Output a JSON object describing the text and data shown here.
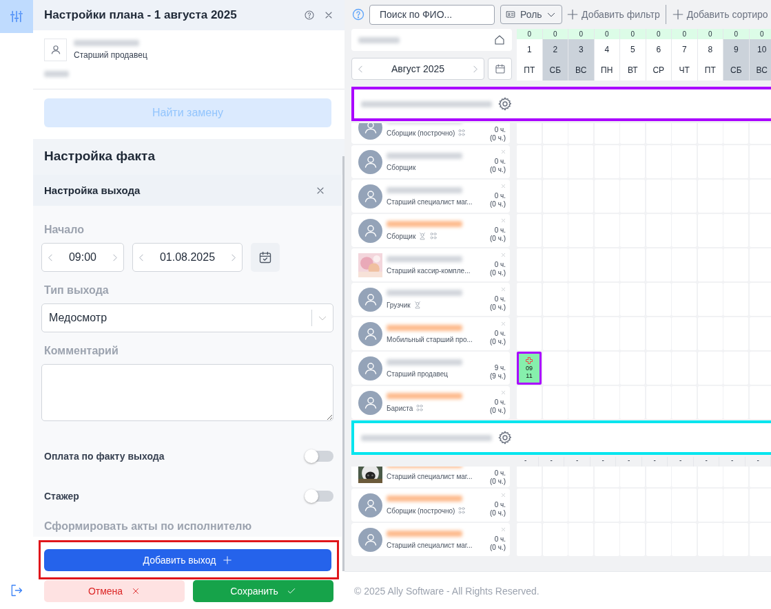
{
  "rail": {
    "top_active": true
  },
  "panel": {
    "title": "Настройки плана - 1 августа 2025",
    "employee": {
      "role": "Старший продавец"
    },
    "find_button": {
      "label": "Найти замену",
      "disabled": true
    },
    "section_title": "Настройка факта",
    "subsection_title": "Настройка выхода",
    "start": {
      "label": "Начало",
      "time": "09:00",
      "date": "01.08.2025"
    },
    "type": {
      "label": "Тип выхода",
      "value": "Медосмотр"
    },
    "comment": {
      "label": "Комментарий"
    },
    "toggles": [
      {
        "label": "Оплата по факту выхода",
        "on": false
      },
      {
        "label": "Стажер",
        "on": false
      }
    ],
    "acts_link": "Сформировать акты по исполнителю",
    "add_button": {
      "label": "Добавить выход",
      "outlined": true
    },
    "cancel_button": "Отмена",
    "save_button": "Сохранить"
  },
  "toolbar": {
    "search_placeholder": "Поиск по ФИО...",
    "role_filter": "Роль",
    "add_filter": "Добавить фильтр",
    "add_sort": "Добавить сортиро"
  },
  "month": "Август 2025",
  "days": [
    {
      "count": "0",
      "day": "1",
      "weekday": "ПТ",
      "weekend": false
    },
    {
      "count": "0",
      "day": "2",
      "weekday": "СБ",
      "weekend": true
    },
    {
      "count": "0",
      "day": "3",
      "weekday": "ВС",
      "weekend": true
    },
    {
      "count": "0",
      "day": "4",
      "weekday": "ПН",
      "weekend": false
    },
    {
      "count": "0",
      "day": "5",
      "weekday": "ВТ",
      "weekend": false
    },
    {
      "count": "0",
      "day": "6",
      "weekday": "СР",
      "weekend": false
    },
    {
      "count": "0",
      "day": "7",
      "weekday": "ЧТ",
      "weekend": false
    },
    {
      "count": "0",
      "day": "8",
      "weekday": "ПТ",
      "weekend": false
    },
    {
      "count": "0",
      "day": "9",
      "weekday": "СБ",
      "weekend": true
    },
    {
      "count": "0",
      "day": "10",
      "weekday": "ВС",
      "weekend": true
    }
  ],
  "groups": [
    {
      "color": "#aa00ff",
      "employees": [
        {
          "partial": true,
          "avatar": {
            "kind": "default"
          },
          "name_highlighted": false,
          "role": "Сборщик (построчно)",
          "badges": [
            {
              "kind": "group"
            }
          ],
          "hours": "0 ч.",
          "planned": "(0 ч.)",
          "removable": false
        },
        {
          "partial": false,
          "avatar": {
            "kind": "default"
          },
          "name_highlighted": false,
          "role": "Сборщик",
          "hours": "0 ч.",
          "planned": "(0 ч.)",
          "removable": true
        },
        {
          "partial": false,
          "avatar": {
            "kind": "default"
          },
          "name_highlighted": false,
          "role": "Старший специалист маг...",
          "hours": "0 ч.",
          "planned": "(0 ч.)",
          "removable": true
        },
        {
          "partial": false,
          "avatar": {
            "kind": "default"
          },
          "name_highlighted": true,
          "role": "Сборщик",
          "badges": [
            {
              "kind": "person"
            },
            {
              "kind": "group"
            }
          ],
          "hours": "0 ч.",
          "planned": "(0 ч.)",
          "removable": true
        },
        {
          "partial": false,
          "name_highlighted": false,
          "role": "Старший кассир-компле...",
          "hours": "0 ч.",
          "planned": "(0 ч.)",
          "removable": true
        },
        {
          "partial": false,
          "avatar": {
            "kind": "default"
          },
          "name_highlighted": false,
          "role": "Грузчик",
          "badges": [
            {
              "kind": "person"
            }
          ],
          "hours": "0 ч.",
          "planned": "(0 ч.)",
          "removable": true
        },
        {
          "partial": false,
          "avatar": {
            "kind": "default"
          },
          "name_highlighted": true,
          "role": "Мобильный старший про...",
          "hours": "0 ч.",
          "planned": "(0 ч.)",
          "removable": true
        },
        {
          "partial": false,
          "avatar": {
            "kind": "default"
          },
          "name_highlighted": false,
          "role": "Старший продавец",
          "hours": "9 ч.",
          "planned": "(9 ч.)",
          "removable": false,
          "cells": [
            {
              "kind": "medical",
              "start": "09",
              "end": "11",
              "outlined": true
            },
            {
              "kind": "empty"
            },
            {
              "kind": "empty"
            },
            {
              "kind": "empty"
            },
            {
              "kind": "empty"
            },
            {
              "kind": "empty"
            },
            {
              "kind": "empty"
            },
            {
              "kind": "empty"
            },
            {
              "kind": "empty"
            },
            {
              "kind": "empty"
            }
          ]
        },
        {
          "partial": false,
          "avatar": {
            "kind": "default"
          },
          "name_highlighted": true,
          "role": "Бариста",
          "badges": [
            {
              "kind": "group"
            }
          ],
          "hours": "0 ч.",
          "planned": "(0 ч.)",
          "removable": true
        }
      ]
    },
    {
      "color": "#00e5ee",
      "summary": [
        "-",
        "-",
        "-",
        "-",
        "-",
        "-",
        "-",
        "-",
        "-",
        "-"
      ],
      "employees": [
        {
          "partial": true,
          "name_highlighted": true,
          "role": "Старший специалист маг...",
          "hours": "0 ч.",
          "planned": "(0 ч.)",
          "removable": false
        },
        {
          "partial": false,
          "avatar": {
            "kind": "default"
          },
          "name_highlighted": true,
          "role": "Сборщик (построчно)",
          "badges": [
            {
              "kind": "group"
            }
          ],
          "hours": "0 ч.",
          "planned": "(0 ч.)",
          "removable": true
        },
        {
          "partial": false,
          "avatar": {
            "kind": "default"
          },
          "name_highlighted": true,
          "role": "Старший специалист маг...",
          "hours": "0 ч.",
          "planned": "(0 ч.)",
          "removable": true
        }
      ]
    }
  ],
  "footer": "© 2025 Ally Software - All Rights Reserved."
}
